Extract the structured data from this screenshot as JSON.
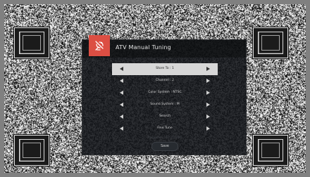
{
  "dialog": {
    "title": "ATV Manual Tuning",
    "icon": "satellite-dish-icon",
    "accent_color": "#dc4e43",
    "menu": [
      {
        "label": "Store To : 1",
        "selected": true
      },
      {
        "label": "Channel : 2",
        "selected": false
      },
      {
        "label": "Color System : NTSC",
        "selected": false
      },
      {
        "label": "Sound System : M",
        "selected": false
      },
      {
        "label": "Search",
        "selected": false
      },
      {
        "label": "Fine Tune",
        "selected": false
      }
    ],
    "frequency_text": "Frequency : 57.25 MHz",
    "save_label": "Save"
  }
}
